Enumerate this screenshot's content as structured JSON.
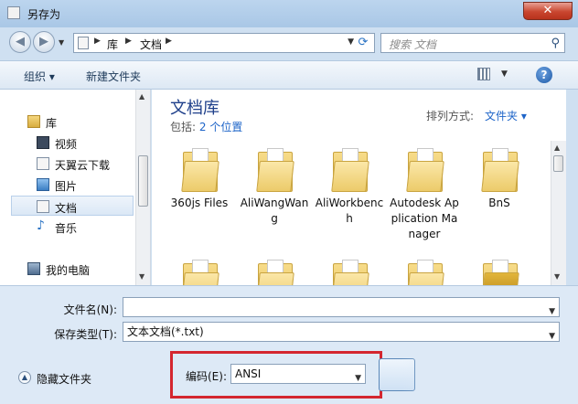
{
  "window": {
    "title": "另存为",
    "close_glyph": "✕"
  },
  "nav": {
    "back_glyph": "◀",
    "forward_glyph": "▶",
    "breadcrumb": [
      "库",
      "文档"
    ],
    "search_placeholder": "搜索 文档"
  },
  "toolbar": {
    "organize": "组织 ▾",
    "new_folder": "新建文件夹",
    "help": "?"
  },
  "sidebar": {
    "items": [
      {
        "label": "库",
        "icon": "library-icon"
      },
      {
        "label": "视频",
        "icon": "video-icon"
      },
      {
        "label": "天翼云下载",
        "icon": "document-icon"
      },
      {
        "label": "图片",
        "icon": "picture-icon"
      },
      {
        "label": "文档",
        "icon": "document-icon",
        "selected": true
      },
      {
        "label": "音乐",
        "icon": "music-icon"
      },
      {
        "label": "我的电脑",
        "icon": "computer-icon"
      }
    ]
  },
  "content": {
    "library_title": "文档库",
    "includes_label": "包括:",
    "includes_link": "2 个位置",
    "arrange_label": "排列方式:",
    "arrange_value": "文件夹 ▾",
    "folders": [
      {
        "name": "360js Files"
      },
      {
        "name": "AliWangWang"
      },
      {
        "name": "AliWorkbench"
      },
      {
        "name": "Autodesk Application Manager"
      },
      {
        "name": "BnS"
      }
    ]
  },
  "form": {
    "filename_label": "文件名(N):",
    "filename_value": "",
    "filetype_label": "保存类型(T):",
    "filetype_value": "文本文档(*.txt)",
    "encoding_label": "编码(E):",
    "encoding_value": "ANSI",
    "hide_folders": "隐藏文件夹"
  },
  "colors": {
    "accent": "#1d64c8",
    "highlight": "#d4262f",
    "folder": "#e7c25a"
  }
}
